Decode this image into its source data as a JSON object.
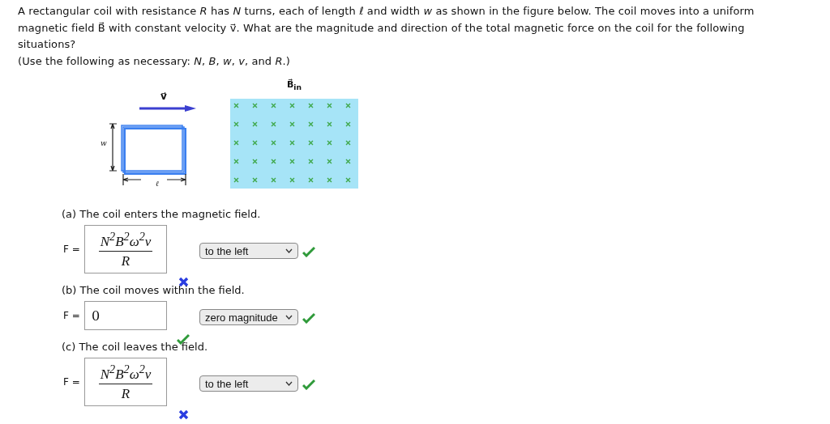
{
  "question": {
    "intro": "A rectangular coil with resistance *R* has *N* turns, each of length *ℓ* and width *w* as shown in the figure below. The coil moves into a uniform magnetic field B⃗ with constant velocity v⃗. What are the magnitude and direction of the total magnetic force on the coil for the following situations?",
    "hint": "(Use the following as necessary: *N*, *B*, *w*, *v*, and *R*.)"
  },
  "figure": {
    "velocity_label": "v⃗",
    "width_label": "w",
    "length_label": "ℓ",
    "field_label": "B⃗$_{in}$"
  },
  "parts": [
    {
      "label": "(a) The coil enters the magnetic field.",
      "force_label": "F =",
      "answer": {
        "kind": "fraction",
        "numerator": "N$^{2}$B$^{2}$ω$^{2}$v",
        "denominator": "R",
        "correct": false
      },
      "direction": {
        "value": "to the left",
        "correct": true
      }
    },
    {
      "label": "(b) The coil moves within the field.",
      "force_label": "F =",
      "answer": {
        "kind": "plain",
        "value": "0",
        "correct": true
      },
      "direction": {
        "value": "zero magnitude",
        "correct": true
      }
    },
    {
      "label": "(c) The coil leaves the field.",
      "force_label": "F =",
      "answer": {
        "kind": "fraction",
        "numerator": "N$^{2}$B$^{2}$ω$^{2}$v",
        "denominator": "R",
        "correct": false
      },
      "direction": {
        "value": "to the left",
        "correct": true
      }
    }
  ]
}
